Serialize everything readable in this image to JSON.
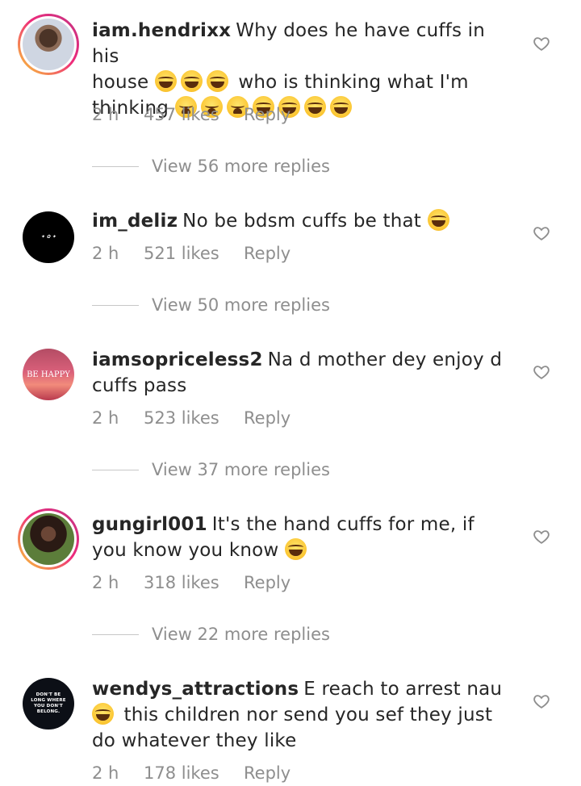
{
  "comments": [
    {
      "username": "iam.hendrixx",
      "text_lines": [
        "Why does he have cuffs in his",
        "house",
        "who is thinking what I'm",
        "thinking"
      ],
      "text": "Why does he have cuffs in his house 😂😂😂 who is thinking what I'm thinking 😩😩😩😂😂😂😂",
      "time": "2 h",
      "likes": "457 likes",
      "reply": "Reply",
      "view_replies": "View 56 more replies",
      "like_icon": "heart-outline-icon"
    },
    {
      "username": "im_deliz",
      "text": "No be bdsm cuffs be that 😂",
      "time": "2 h",
      "likes": "521 likes",
      "reply": "Reply",
      "view_replies": "View 50 more replies",
      "like_icon": "heart-outline-icon"
    },
    {
      "username": "iamsopriceless2",
      "text": "Na d mother dey enjoy d cuffs pass",
      "avatar_text": "BE HAPPY",
      "time": "2 h",
      "likes": "523 likes",
      "reply": "Reply",
      "view_replies": "View 37 more replies",
      "like_icon": "heart-outline-icon"
    },
    {
      "username": "gungirl001",
      "text": "It's the hand cuffs for me, if you know you know 😂",
      "time": "2 h",
      "likes": "318 likes",
      "reply": "Reply",
      "view_replies": "View 22 more replies",
      "like_icon": "heart-outline-icon"
    },
    {
      "username": "wendys_attractions",
      "text": "E reach to arrest nau 😂 this children nor send you sef they just do whatever they like",
      "avatar_text": "DON'T BE LONG WHERE YOU DON'T BELONG.",
      "time": "2 h",
      "likes": "178 likes",
      "reply": "Reply",
      "like_icon": "heart-outline-icon"
    }
  ],
  "colors": {
    "text": "#262626",
    "muted": "#8e8e8e",
    "story_ring_start": "#f9ce34",
    "story_ring_end": "#c13584"
  }
}
